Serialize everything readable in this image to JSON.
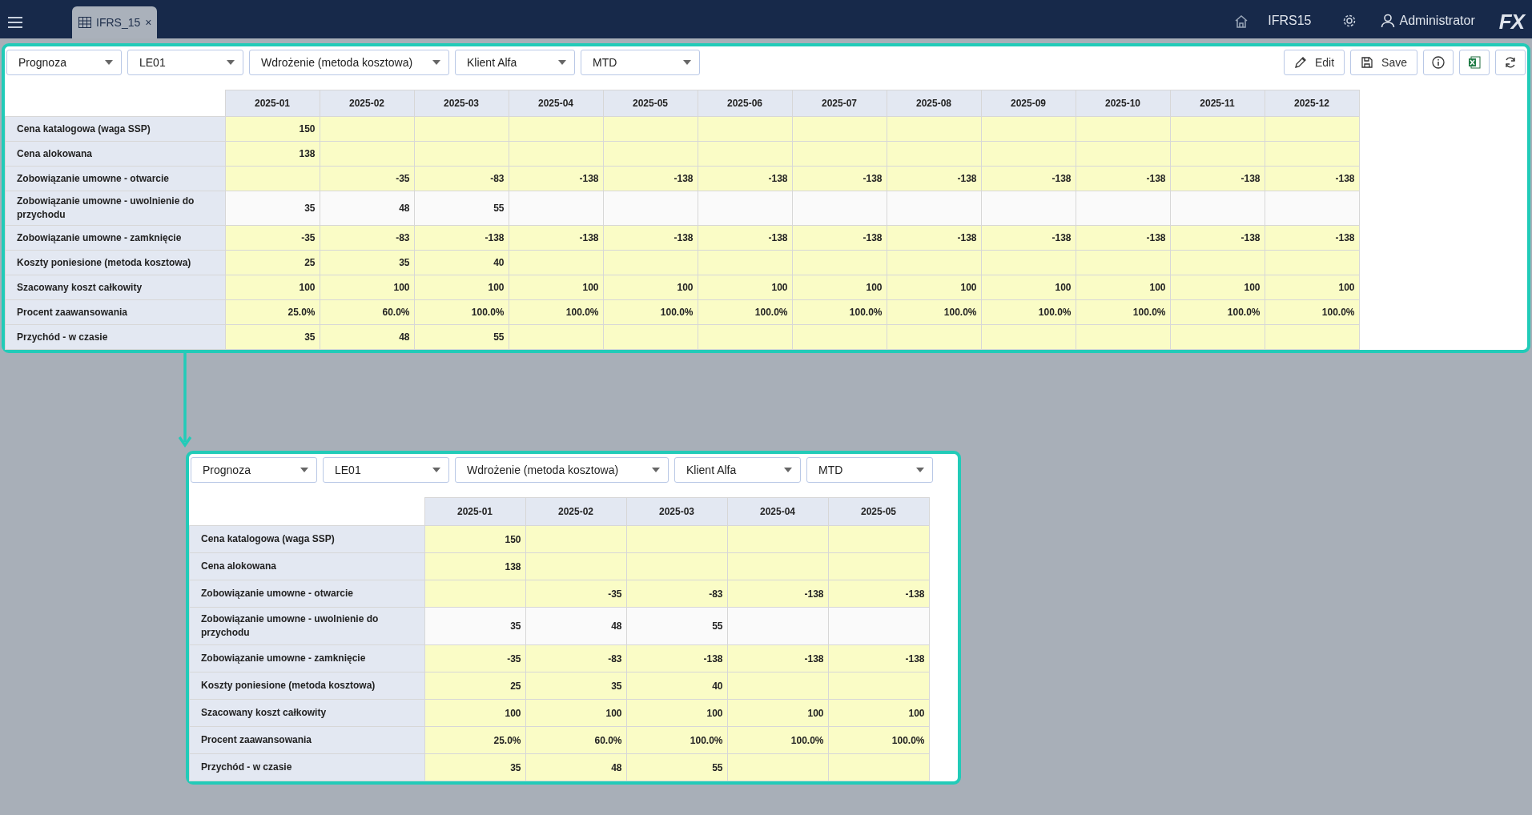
{
  "top_bar": {
    "tab": {
      "label": "IFRS_15",
      "close": "×",
      "selected": true
    },
    "module": "IFRS15",
    "user": "Administrator",
    "logo": "FX"
  },
  "panels": [
    {
      "filters": [
        {
          "value": "Prognoza"
        },
        {
          "value": "LE01"
        },
        {
          "value": "Wdrożenie (metoda kosztowa)"
        },
        {
          "value": "Klient Alfa"
        },
        {
          "value": "MTD"
        }
      ],
      "toolbar": [
        {
          "kind": "edit",
          "label": "Edit"
        },
        {
          "kind": "save",
          "label": "Save"
        },
        {
          "kind": "info"
        },
        {
          "kind": "excel"
        },
        {
          "kind": "refresh"
        }
      ],
      "table": {
        "columns": [
          "2025-01",
          "2025-02",
          "2025-03",
          "2025-04",
          "2025-05",
          "2025-06",
          "2025-07",
          "2025-08",
          "2025-09",
          "2025-10",
          "2025-11",
          "2025-12"
        ],
        "rows": [
          {
            "label": "Cena katalogowa (waga SSP)",
            "editable": true,
            "values": [
              "150"
            ]
          },
          {
            "label": "Cena alokowana",
            "editable": true,
            "values": [
              "138"
            ]
          },
          {
            "label": "Zobowiązanie umowne - otwarcie",
            "editable": true,
            "leading_blank": true,
            "values": [
              "-35",
              "-83",
              "-138",
              "-138",
              "-138",
              "-138",
              "-138",
              "-138",
              "-138",
              "-138",
              "-138"
            ]
          },
          {
            "label": "Zobowiązanie umowne - uwolnienie do przychodu",
            "editable": false,
            "values": [
              "35",
              "48",
              "55"
            ]
          },
          {
            "label": "Zobowiązanie umowne - zamknięcie",
            "editable": true,
            "values": [
              "-35",
              "-83",
              "-138",
              "-138",
              "-138",
              "-138",
              "-138",
              "-138",
              "-138",
              "-138",
              "-138",
              "-138"
            ]
          },
          {
            "label": "Koszty poniesione (metoda kosztowa)",
            "editable": true,
            "values": [
              "25",
              "35",
              "40"
            ]
          },
          {
            "label": "Szacowany koszt całkowity",
            "editable": true,
            "values": [
              "100",
              "100",
              "100",
              "100",
              "100",
              "100",
              "100",
              "100",
              "100",
              "100",
              "100",
              "100"
            ]
          },
          {
            "label": "Procent zaawansowania",
            "editable": true,
            "values": [
              "25.0%",
              "60.0%",
              "100.0%",
              "100.0%",
              "100.0%",
              "100.0%",
              "100.0%",
              "100.0%",
              "100.0%",
              "100.0%",
              "100.0%",
              "100.0%"
            ]
          },
          {
            "label": "Przychód - w czasie",
            "editable": true,
            "values": [
              "35",
              "48",
              "55"
            ]
          }
        ]
      }
    },
    {
      "filters": [
        {
          "value": "Prognoza"
        },
        {
          "value": "LE01"
        },
        {
          "value": "Wdrożenie (metoda kosztowa)"
        },
        {
          "value": "Klient Alfa"
        },
        {
          "value": "MTD"
        }
      ],
      "table": {
        "columns": [
          "2025-01",
          "2025-02",
          "2025-03",
          "2025-04",
          "2025-05"
        ],
        "rows": [
          {
            "label": "Cena katalogowa (waga SSP)",
            "editable": true,
            "values": [
              "150"
            ]
          },
          {
            "label": "Cena alokowana",
            "editable": true,
            "values": [
              "138"
            ]
          },
          {
            "label": "Zobowiązanie umowne - otwarcie",
            "editable": true,
            "leading_blank": true,
            "values": [
              "-35",
              "-83",
              "-138",
              "-138"
            ]
          },
          {
            "label": "Zobowiązanie umowne - uwolnienie do przychodu",
            "editable": false,
            "values": [
              "35",
              "48",
              "55"
            ]
          },
          {
            "label": "Zobowiązanie umowne - zamknięcie",
            "editable": true,
            "values": [
              "-35",
              "-83",
              "-138",
              "-138",
              "-138"
            ]
          },
          {
            "label": "Koszty poniesione (metoda kosztowa)",
            "editable": true,
            "values": [
              "25",
              "35",
              "40"
            ]
          },
          {
            "label": "Szacowany koszt całkowity",
            "editable": true,
            "values": [
              "100",
              "100",
              "100",
              "100",
              "100"
            ]
          },
          {
            "label": "Procent zaawansowania",
            "editable": true,
            "values": [
              "25.0%",
              "60.0%",
              "100.0%",
              "100.0%",
              "100.0%"
            ]
          },
          {
            "label": "Przychód - w czasie",
            "editable": true,
            "values": [
              "35",
              "48",
              "55"
            ]
          }
        ]
      }
    }
  ]
}
